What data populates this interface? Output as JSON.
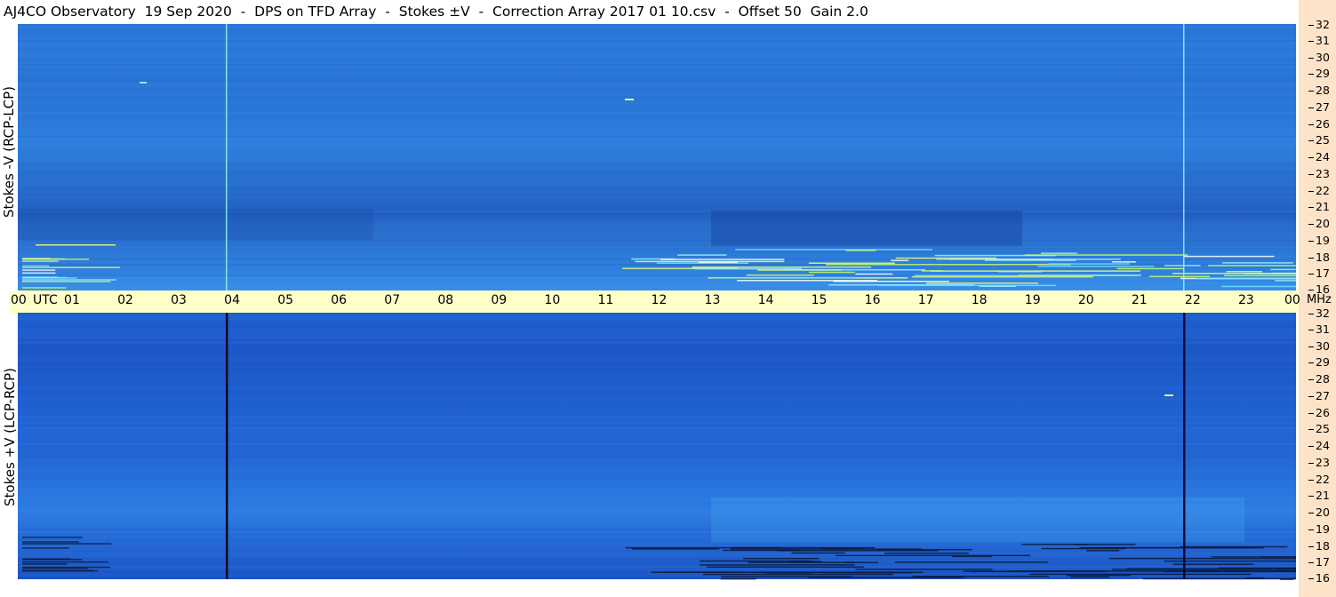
{
  "title": "AJ4CO Observatory  19 Sep 2020  -  DPS on TFD Array  -  Stokes ±V  -  Correction Array 2017 01 10.csv  -  Offset 50  Gain 2.0",
  "chart_data": {
    "type": "heatmap",
    "title": "AJ4CO Observatory  19 Sep 2020  -  DPS on TFD Array  -  Stokes ±V  -  Correction Array 2017 01 10.csv  -  Offset 50  Gain 2.0",
    "xlabel": "UTC",
    "ylabel_unit": "MHz",
    "x_ticks": [
      "00",
      "01",
      "02",
      "03",
      "04",
      "05",
      "06",
      "07",
      "08",
      "09",
      "10",
      "11",
      "12",
      "13",
      "14",
      "15",
      "16",
      "17",
      "18",
      "19",
      "20",
      "21",
      "22",
      "23",
      "00"
    ],
    "xlim": [
      0,
      24
    ],
    "ylim": [
      16,
      32
    ],
    "y_ticks": [
      32,
      31,
      30,
      29,
      28,
      27,
      26,
      25,
      24,
      23,
      22,
      21,
      20,
      19,
      18,
      17,
      16
    ],
    "panels": [
      {
        "name": "Stokes -V (RCP-LCP)",
        "position": "top"
      },
      {
        "name": "Stokes +V (LCP-RCP)",
        "position": "bottom"
      }
    ],
    "colors": {
      "background": "#2a78d9",
      "timebar": "#ffffc8",
      "right_strip": "#fde3c8"
    }
  }
}
